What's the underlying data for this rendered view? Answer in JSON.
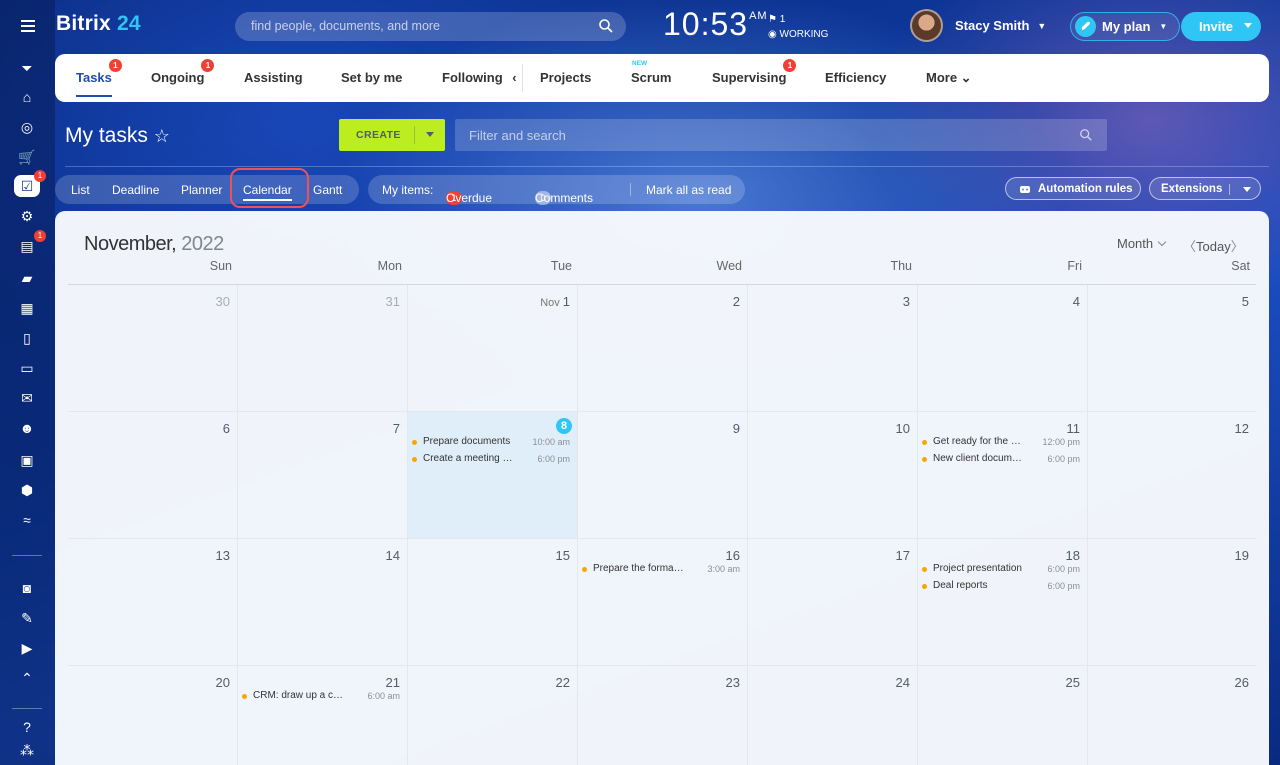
{
  "header": {
    "logo_main": "Bitrix",
    "logo_num": "24",
    "search_placeholder": "find people, documents, and more",
    "time": "10:53",
    "ampm": "AM",
    "flag_count": "1",
    "work_status": "WORKING",
    "user_name": "Stacy Smith",
    "plan_label": "My plan",
    "invite_label": "Invite"
  },
  "left_rail": {
    "items": [
      {
        "icon": "filter-icon",
        "badge": ""
      },
      {
        "icon": "home-icon",
        "badge": ""
      },
      {
        "icon": "target-icon",
        "badge": ""
      },
      {
        "icon": "cart-icon",
        "badge": ""
      },
      {
        "icon": "tasks-icon",
        "badge": "1",
        "selected": true
      },
      {
        "icon": "flow-icon",
        "badge": ""
      },
      {
        "icon": "feed-icon",
        "badge": "1"
      },
      {
        "icon": "chat-icon",
        "badge": ""
      },
      {
        "icon": "calendar-icon",
        "badge": ""
      },
      {
        "icon": "document-icon",
        "badge": ""
      },
      {
        "icon": "drive-icon",
        "badge": ""
      },
      {
        "icon": "mail-icon",
        "badge": ""
      },
      {
        "icon": "people-icon",
        "badge": ""
      },
      {
        "icon": "contact-card-icon",
        "badge": ""
      },
      {
        "icon": "box-icon",
        "badge": ""
      },
      {
        "icon": "settings-sliders-icon",
        "badge": ""
      },
      {
        "icon": "robot-icon",
        "badge": ""
      },
      {
        "icon": "sign-icon",
        "badge": ""
      },
      {
        "icon": "video-icon",
        "badge": ""
      },
      {
        "icon": "collapse-icon",
        "badge": ""
      },
      {
        "icon": "help-icon",
        "badge": ""
      },
      {
        "icon": "sitemap-icon",
        "badge": ""
      }
    ]
  },
  "tabs": [
    {
      "label": "Tasks",
      "badge": "1",
      "active": true
    },
    {
      "label": "Ongoing",
      "badge": "1"
    },
    {
      "label": "Assisting"
    },
    {
      "label": "Set by me"
    },
    {
      "label": "Following"
    },
    {
      "label": "Projects"
    },
    {
      "label": "Scrum",
      "new": "NEW"
    },
    {
      "label": "Supervising",
      "badge": "1"
    },
    {
      "label": "Efficiency"
    },
    {
      "label": "More"
    }
  ],
  "toolbar": {
    "page_title": "My tasks",
    "create_label": "CREATE",
    "filter_placeholder": "Filter and search"
  },
  "views": [
    "List",
    "Deadline",
    "Planner",
    "Calendar",
    "Gantt"
  ],
  "my_items": {
    "label": "My items:",
    "overdue_count": "1",
    "overdue_label": "Overdue",
    "comments_count": "0",
    "comments_label": "Comments",
    "mark_read": "Mark all as read"
  },
  "actions": {
    "automation": "Automation rules",
    "extensions": "Extensions"
  },
  "calendar": {
    "month": "November,",
    "year": "2022",
    "view": "Month",
    "today": "Today",
    "weekdays": [
      "Sun",
      "Mon",
      "Tue",
      "Wed",
      "Thu",
      "Fri",
      "Sat"
    ],
    "weeks": [
      [
        {
          "d": "30",
          "gray": true
        },
        {
          "d": "31",
          "gray": true
        },
        {
          "d": "1",
          "pre": "Nov"
        },
        {
          "d": "2"
        },
        {
          "d": "3"
        },
        {
          "d": "4"
        },
        {
          "d": "5"
        }
      ],
      [
        {
          "d": "6"
        },
        {
          "d": "7"
        },
        {
          "d": "8",
          "today": true,
          "events": [
            {
              "t": "Prepare documents",
              "tm": "10:00 am"
            },
            {
              "t": "Create a meeting ag…",
              "tm": "6:00 pm"
            }
          ]
        },
        {
          "d": "9"
        },
        {
          "d": "10"
        },
        {
          "d": "11",
          "events": [
            {
              "t": "Get ready for the m…",
              "tm": "12:00 pm"
            },
            {
              "t": "New client documen…",
              "tm": "6:00 pm"
            }
          ]
        },
        {
          "d": "12"
        }
      ],
      [
        {
          "d": "13"
        },
        {
          "d": "14"
        },
        {
          "d": "15"
        },
        {
          "d": "16",
          "events": [
            {
              "t": "Prepare the formal in…",
              "tm": "3:00 am"
            }
          ]
        },
        {
          "d": "17"
        },
        {
          "d": "18",
          "events": [
            {
              "t": "Project presentation",
              "tm": "6:00 pm"
            },
            {
              "t": "Deal reports",
              "tm": "6:00 pm"
            }
          ]
        },
        {
          "d": "19"
        }
      ],
      [
        {
          "d": "20"
        },
        {
          "d": "21",
          "events": [
            {
              "t": "CRM: draw up a cont…",
              "tm": "6:00 am"
            }
          ]
        },
        {
          "d": "22"
        },
        {
          "d": "23"
        },
        {
          "d": "24"
        },
        {
          "d": "25"
        },
        {
          "d": "26"
        }
      ]
    ]
  }
}
